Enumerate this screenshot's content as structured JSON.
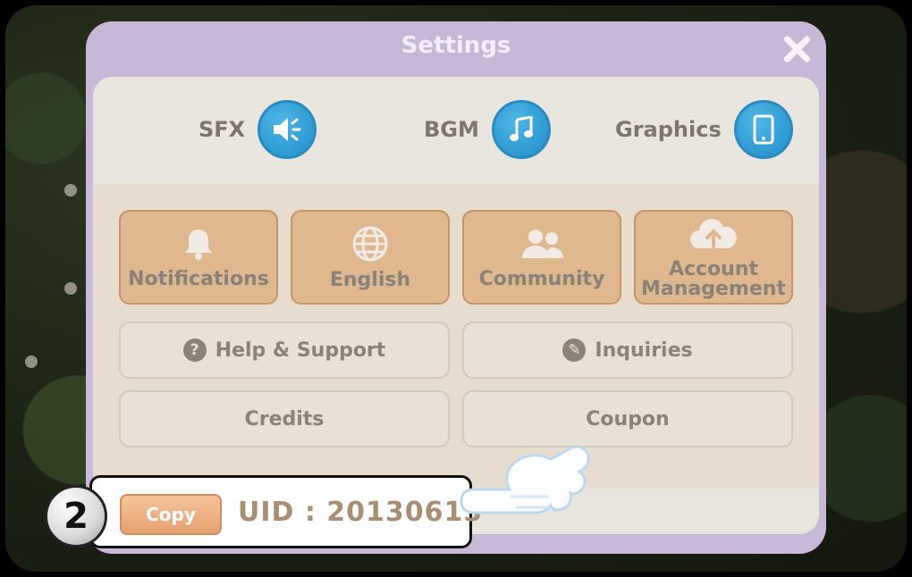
{
  "dialog": {
    "title": "Settings"
  },
  "toggles": [
    {
      "label": "SFX",
      "icon": "speaker-icon"
    },
    {
      "label": "BGM",
      "icon": "music-note-icon"
    },
    {
      "label": "Graphics",
      "icon": "tablet-icon"
    }
  ],
  "big_buttons": [
    {
      "label": "Notifications",
      "icon": "bell-icon"
    },
    {
      "label": "English",
      "icon": "globe-icon"
    },
    {
      "label": "Community",
      "icon": "people-icon"
    },
    {
      "label_line1": "Account",
      "label_line2": "Management",
      "icon": "cloud-upload-icon"
    }
  ],
  "wide_buttons": {
    "help": "Help & Support",
    "inquiries": "Inquiries",
    "credits": "Credits",
    "coupon": "Coupon"
  },
  "footer": {
    "copy_label": "Copy",
    "uid_text": "UID : 20130613"
  },
  "tutorial": {
    "step_number": "2"
  },
  "colors": {
    "accent_blue": "#1f8fc9",
    "button_tan": "#dfb890",
    "dialog_purple": "#c9b9d9"
  }
}
